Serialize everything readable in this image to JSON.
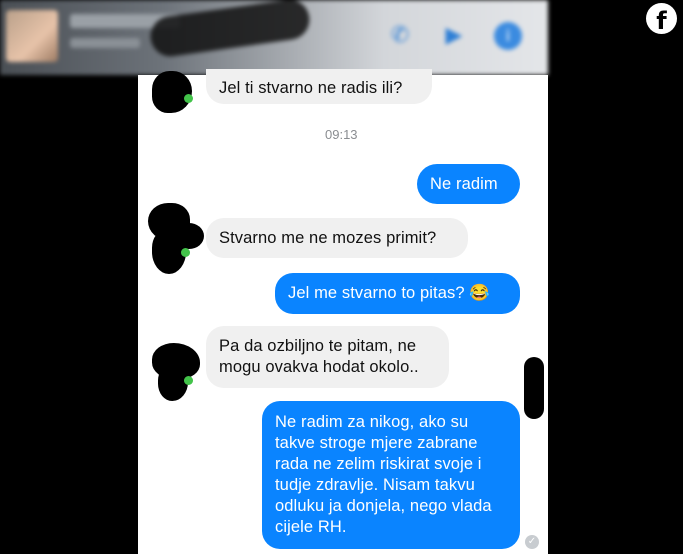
{
  "header": {
    "contact_name": "",
    "status": "",
    "phone_icon": "phone-icon",
    "video_icon": "video-icon",
    "info_icon": "info-icon"
  },
  "facebook_logo": "f",
  "timestamp": "09:13",
  "messages": [
    {
      "from": "them",
      "text": "Jel ti stvarno ne radis ili?"
    },
    {
      "from": "me",
      "text": "Ne radim"
    },
    {
      "from": "them",
      "text": "Stvarno me ne mozes primit?"
    },
    {
      "from": "me",
      "text": "Jel me stvarno to pitas? 😂"
    },
    {
      "from": "them",
      "text": "Pa da ozbiljno te pitam, ne mogu ovakva hodat okolo.."
    },
    {
      "from": "me",
      "text": "Ne radim za nikog, ako su takve stroge mjere zabrane rada ne zelim riskirat svoje i tudje zdravlje. Nisam takvu odluku ja donjela, nego vlada cijele RH."
    }
  ],
  "colors": {
    "outgoing_bubble": "#0a84ff",
    "incoming_bubble": "#f0f0f0",
    "online_dot": "#43c34a"
  }
}
